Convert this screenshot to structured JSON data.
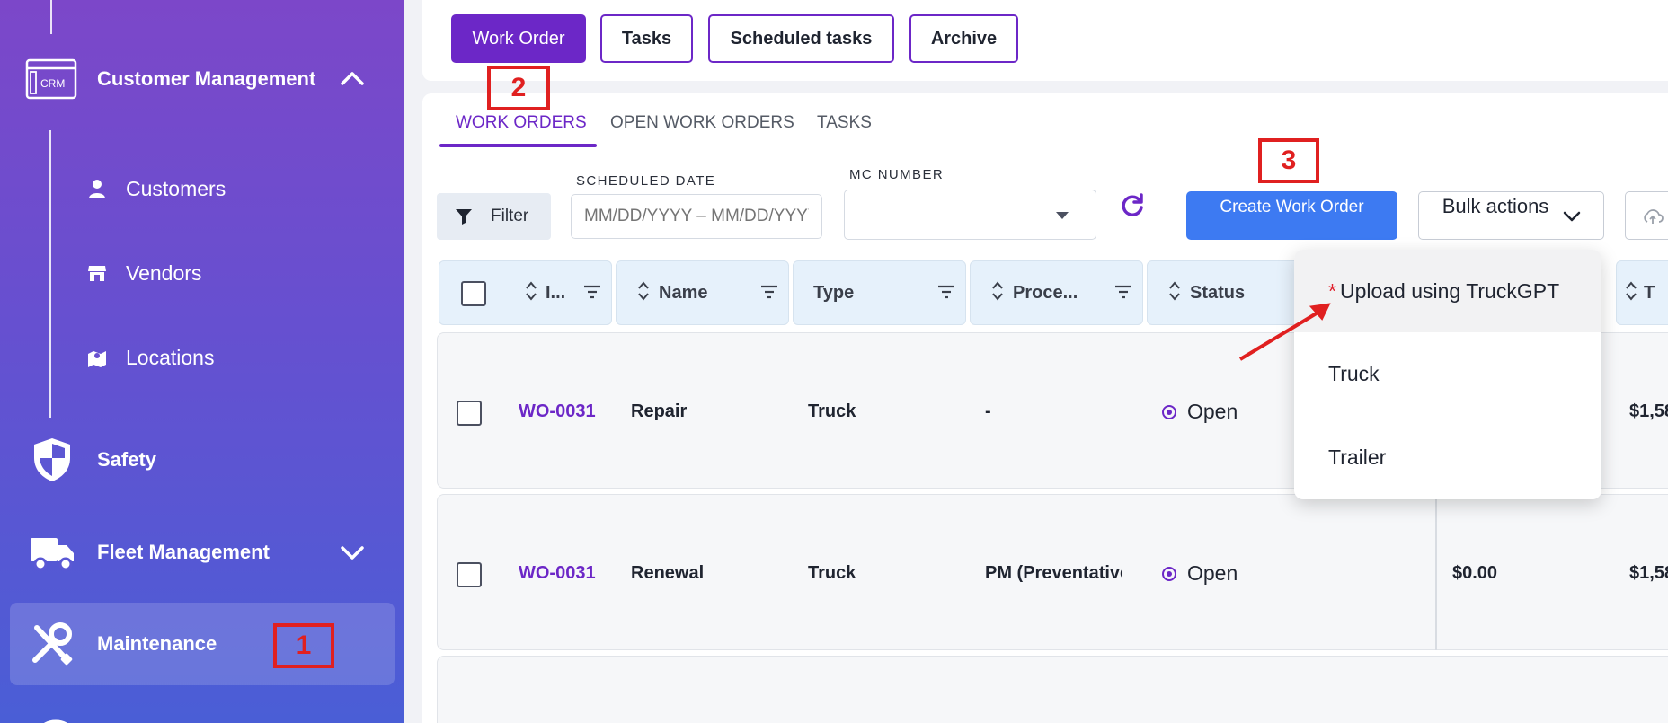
{
  "sidebar": {
    "group_label": "Customer Management",
    "crm_icon_text": "CRM",
    "sub_items": [
      {
        "label": "Customers",
        "icon": "person-icon"
      },
      {
        "label": "Vendors",
        "icon": "store-icon"
      },
      {
        "label": "Locations",
        "icon": "map-pin-icon"
      }
    ],
    "items": [
      {
        "label": "Safety",
        "icon": "shield-icon"
      },
      {
        "label": "Fleet Management",
        "icon": "truck-icon"
      },
      {
        "label": "Maintenance",
        "icon": "wrench-screwdriver-icon",
        "active": true
      }
    ]
  },
  "top_buttons": [
    {
      "label": "Work Order",
      "active": true
    },
    {
      "label": "Tasks"
    },
    {
      "label": "Scheduled tasks"
    },
    {
      "label": "Archive"
    }
  ],
  "tabs": [
    "WORK ORDERS",
    "OPEN WORK ORDERS",
    "TASKS"
  ],
  "active_tab": "WORK ORDERS",
  "toolbar": {
    "filter_label": "Filter",
    "scheduled_date_label": "SCHEDULED DATE",
    "scheduled_date_placeholder": "MM/DD/YYYY – MM/DD/YYYY",
    "mc_number_label": "MC NUMBER",
    "mc_number_value": "",
    "create_label": "Create Work Order",
    "bulk_label": "Bulk actions"
  },
  "columns": [
    "I...",
    "Name",
    "Type",
    "Proce...",
    "Status",
    "T"
  ],
  "rows": [
    {
      "id": "WO-0031",
      "name": "Repair",
      "type": "Truck",
      "procedure": "-",
      "status": "Open",
      "amount": "",
      "total": "$1,58"
    },
    {
      "id": "WO-0031",
      "name": "Renewal",
      "type": "Truck",
      "procedure": "PM (Preventative",
      "status": "Open",
      "amount": "$0.00",
      "total": "$1,58"
    }
  ],
  "dropdown": {
    "items": [
      {
        "label": "Upload using TruckGPT",
        "required_mark": "*"
      },
      {
        "label": "Truck"
      },
      {
        "label": "Trailer"
      }
    ]
  },
  "annotations": [
    "1",
    "2",
    "3"
  ],
  "colors": {
    "accent": "#6c27c7",
    "primary_button": "#3d7af2",
    "annotation_red": "#e02020",
    "sidebar_top": "#7c47c9",
    "sidebar_bottom": "#4a5ed6"
  }
}
